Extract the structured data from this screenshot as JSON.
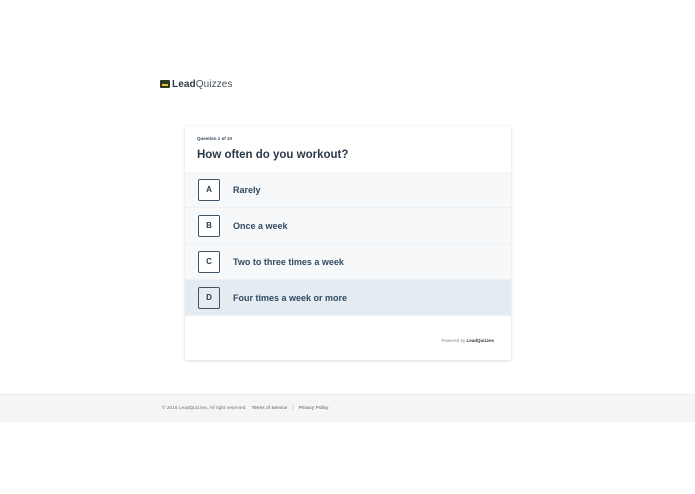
{
  "brand": {
    "name_bold": "Lead",
    "name_light": "Quizzes"
  },
  "quiz": {
    "counter": "Question 1 of 10",
    "question": "How often do you workout?",
    "answers": [
      {
        "key": "A",
        "label": "Rarely"
      },
      {
        "key": "B",
        "label": "Once a week"
      },
      {
        "key": "C",
        "label": "Two to three times a week"
      },
      {
        "key": "D",
        "label": "Four times a week or more"
      }
    ],
    "highlighted_answer": "D",
    "powered_prefix": "Powered by",
    "powered_brand": "LeadQuizzes"
  },
  "footer": {
    "copyright": "© 2016 LeadQuizzes. All right reserved.",
    "terms": "Terms of Service",
    "separator": "|",
    "privacy": "Privacy Policy"
  },
  "colors": {
    "answer_bg": "#f6f8f9",
    "answer_highlight": "#e4ecf1",
    "text_dark": "#2b3a4a",
    "logo_accent": "#f2c029"
  }
}
